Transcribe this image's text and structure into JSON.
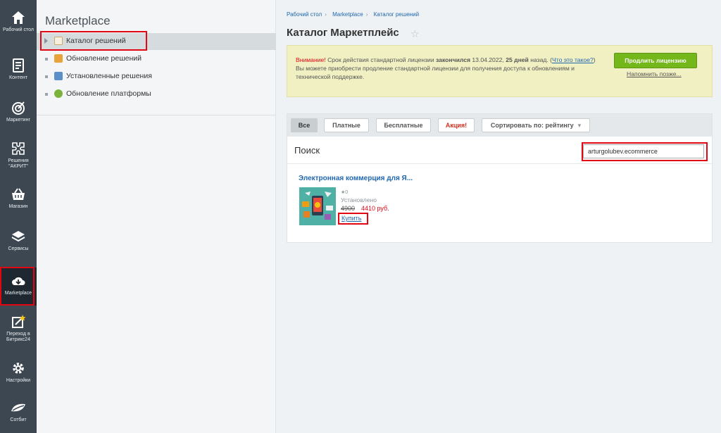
{
  "sidebar": {
    "items": [
      {
        "label": "Рабочий стол",
        "icon": "home-icon"
      },
      {
        "label": "Контент",
        "icon": "document-icon"
      },
      {
        "label": "Маркетинг",
        "icon": "target-icon"
      },
      {
        "label": "Решения \"АКРИТ\"",
        "icon": "puzzle-icon"
      },
      {
        "label": "Магазин",
        "icon": "basket-icon"
      },
      {
        "label": "Сервисы",
        "icon": "layers-icon"
      },
      {
        "label": "Marketplace",
        "icon": "cloud-download-icon"
      },
      {
        "label": "Переход в Битрикс24",
        "icon": "external-edit-icon"
      },
      {
        "label": "Настройки",
        "icon": "gear-icon"
      },
      {
        "label": "Сотбит",
        "icon": "sotbit-logo-icon"
      }
    ]
  },
  "submenu": {
    "title": "Marketplace",
    "items": [
      {
        "label": "Каталог решений",
        "icon": "catalog-icon",
        "icon_color": "#c9a86a"
      },
      {
        "label": "Обновление решений",
        "icon": "update-solutions-icon",
        "icon_color": "#e8a43a"
      },
      {
        "label": "Установленные решения",
        "icon": "installed-solutions-icon",
        "icon_color": "#5a8fc9"
      },
      {
        "label": "Обновление платформы",
        "icon": "platform-update-icon",
        "icon_color": "#7ab33a"
      }
    ]
  },
  "breadcrumb": [
    "Рабочий стол",
    "Marketplace",
    "Каталог решений"
  ],
  "page": {
    "title": "Каталог Маркетплейс"
  },
  "notice": {
    "warning": "Внимание!",
    "text1": " Срок действия стандартной лицензии ",
    "expired": "закончился",
    "date": " 13.04.2022, ",
    "days": "25 дней",
    "text2": " назад. (",
    "whatlink": "Что это такое?",
    "text3": ")",
    "text4": "Вы можете приобрести продление стандартной лицензии для получения доступа к обновлениям и технической поддержке.",
    "renew_button": "Продлить лицензию",
    "remind_link": "Напомнить позже..."
  },
  "filters": {
    "all": "Все",
    "paid": "Платные",
    "free": "Бесплатные",
    "sale": "Акция!",
    "sort": "Сортировать по: рейтингу"
  },
  "search": {
    "label": "Поиск",
    "value": "arturgolubev.ecommerce"
  },
  "product": {
    "title": "Электронная коммерция для Я...",
    "rating": "★0",
    "status": "Установлено",
    "old_price": "4900",
    "new_price": "4410 руб.",
    "buy": "Купить"
  },
  "colors": {
    "sidebar_bg": "#3c4752",
    "accent_green": "#74b71b",
    "link_blue": "#2067b0",
    "alert_red": "#e30613",
    "highlight_box": "#e30613"
  }
}
